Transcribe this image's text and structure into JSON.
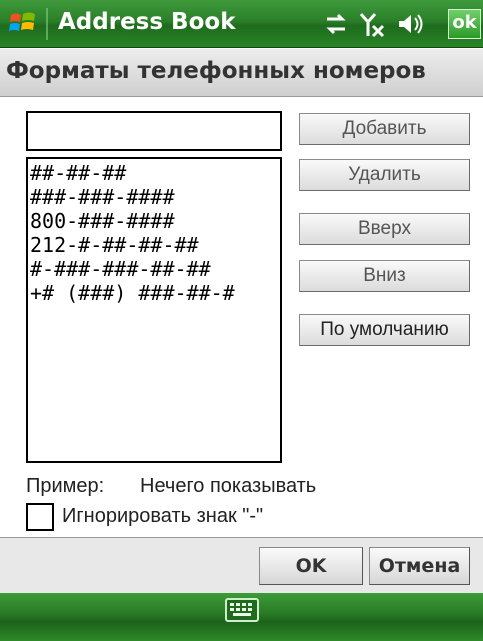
{
  "titlebar": {
    "app_title": "Address Book",
    "ok_label": "ok"
  },
  "header": {
    "title": "Форматы телефонных номеров"
  },
  "format_input": {
    "value": ""
  },
  "format_list": {
    "items": [
      "##-##-##",
      "###-###-####",
      "800-###-####",
      "212-#-##-##-##",
      "#-###-###-##-##",
      "+# (###) ###-##-#"
    ]
  },
  "buttons": {
    "add": "Добавить",
    "delete": "Удалить",
    "up": "Вверх",
    "down": "Вниз",
    "default": "По умолчанию"
  },
  "example": {
    "label": "Пример:",
    "value": "Нечего показывать"
  },
  "ignore_dash": {
    "label": "Игнорировать знак \"-\"",
    "checked": false
  },
  "dialog_buttons": {
    "ok": "OK",
    "cancel": "Отмена"
  },
  "colors": {
    "titlebar_green": "#2a7f28",
    "header_gray": "#dcdcdc"
  },
  "icons": {
    "start": "windows-logo-icon",
    "connectivity": "connectivity-icon",
    "signal": "signal-off-icon",
    "volume": "volume-icon",
    "keyboard": "keyboard-icon"
  }
}
